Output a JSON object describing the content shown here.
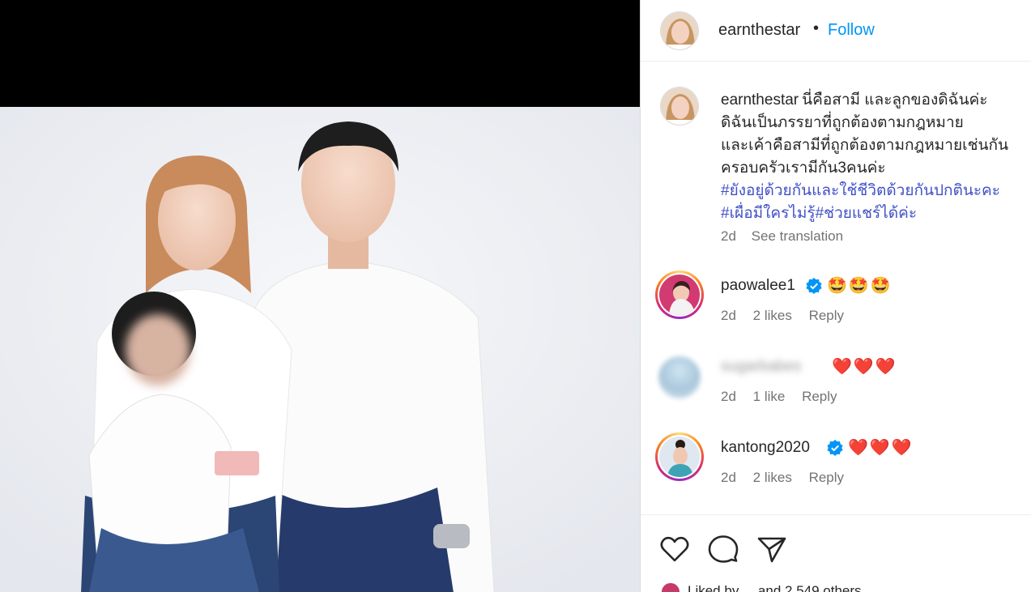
{
  "post": {
    "username": "earnthestar",
    "dot": "•",
    "follow_label": "Follow",
    "caption_lines": [
      "นี่คือสามี และลูกของดิฉันค่ะ",
      "ดิฉันเป็นภรรยาที่ถูกต้องตามกฎหมาย",
      "และเค้าคือสามีที่ถูกต้องตามกฎหมายเช่นกัน",
      "ครอบครัวเรามีกัน3คนค่ะ"
    ],
    "hashtags": [
      "#ยังอยู่ด้วยกันและใช้ชีวิตด้วยกันปกตินะคะ",
      "#เผื่อมีใครไม่รู้#ช่วยแชร์ได้ค่ะ"
    ],
    "time": "2d",
    "see_translation": "See translation"
  },
  "comments": [
    {
      "username": "paowalee1",
      "verified": true,
      "text": "🤩🤩🤩",
      "time": "2d",
      "likes": "2 likes",
      "reply": "Reply"
    },
    {
      "username": "sugarbabes",
      "blurred": true,
      "text": "❤️❤️❤️",
      "time": "2d",
      "likes": "1 like",
      "reply": "Reply"
    },
    {
      "username": "kantong2020",
      "verified": true,
      "text": "❤️❤️❤️",
      "time": "2d",
      "likes": "2 likes",
      "reply": "Reply"
    }
  ],
  "actions": {
    "like_icon": "heart-icon",
    "comment_icon": "comment-icon",
    "share_icon": "send-icon",
    "liked_by": "Liked by ... and 2,549 others"
  },
  "colors": {
    "follow": "#0095f6",
    "hashtag": "#3f51c6",
    "verified": "#0095f6",
    "meta": "#737373"
  }
}
